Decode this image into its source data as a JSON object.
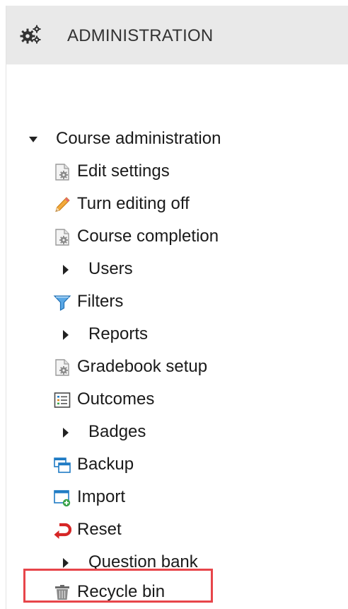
{
  "block": {
    "title": "ADMINISTRATION",
    "header_icon": "gears-icon"
  },
  "tree": {
    "root": {
      "label": "Course administration",
      "state": "expanded",
      "icon": "caret-down-icon"
    },
    "items": [
      {
        "label": "Edit settings",
        "icon": "settings-page-icon"
      },
      {
        "label": "Turn editing off",
        "icon": "pencil-icon"
      },
      {
        "label": "Course completion",
        "icon": "settings-page-icon"
      },
      {
        "label": "Users",
        "icon": "caret-right-icon"
      },
      {
        "label": "Filters",
        "icon": "filter-icon"
      },
      {
        "label": "Reports",
        "icon": "caret-right-icon"
      },
      {
        "label": "Gradebook setup",
        "icon": "settings-page-icon"
      },
      {
        "label": "Outcomes",
        "icon": "outcomes-icon"
      },
      {
        "label": "Badges",
        "icon": "caret-right-icon"
      },
      {
        "label": "Backup",
        "icon": "backup-icon"
      },
      {
        "label": "Import",
        "icon": "import-icon"
      },
      {
        "label": "Reset",
        "icon": "reset-icon"
      },
      {
        "label": "Question bank",
        "icon": "caret-right-icon"
      },
      {
        "label": "Recycle bin",
        "icon": "trash-icon"
      }
    ]
  },
  "colors": {
    "header_bg": "#e9e9e9",
    "highlight_border": "#e7454a",
    "link_blue": "#1f7bc4"
  }
}
